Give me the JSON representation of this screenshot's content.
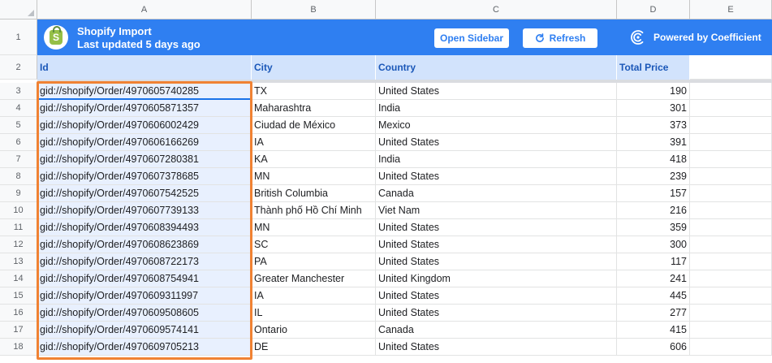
{
  "columns": [
    "A",
    "B",
    "C",
    "D",
    "E"
  ],
  "rows": [
    "1",
    "2",
    "3",
    "4",
    "5",
    "6",
    "7",
    "8",
    "9",
    "10",
    "11",
    "12",
    "13",
    "14",
    "15",
    "16",
    "17",
    "18"
  ],
  "banner": {
    "title": "Shopify Import",
    "subtitle": "Last updated 5 days ago",
    "open_sidebar_label": "Open Sidebar",
    "refresh_label": "Refresh",
    "powered_label": "Powered by Coefficient",
    "bg_color": "#2f7ff1"
  },
  "headers": [
    "Id",
    "City",
    "Country",
    "Total Price"
  ],
  "table": [
    {
      "id": "gid://shopify/Order/4970605740285",
      "city": "TX",
      "country": "United States",
      "price": "190"
    },
    {
      "id": "gid://shopify/Order/4970605871357",
      "city": "Maharashtra",
      "country": "India",
      "price": "301"
    },
    {
      "id": "gid://shopify/Order/4970606002429",
      "city": "Ciudad de México",
      "country": "Mexico",
      "price": "373"
    },
    {
      "id": "gid://shopify/Order/4970606166269",
      "city": "IA",
      "country": "United States",
      "price": "391"
    },
    {
      "id": "gid://shopify/Order/4970607280381",
      "city": "KA",
      "country": "India",
      "price": "418"
    },
    {
      "id": "gid://shopify/Order/4970607378685",
      "city": "MN",
      "country": "United States",
      "price": "239"
    },
    {
      "id": "gid://shopify/Order/4970607542525",
      "city": "British Columbia",
      "country": "Canada",
      "price": "157"
    },
    {
      "id": "gid://shopify/Order/4970607739133",
      "city": "Thành phố Hồ Chí Minh",
      "country": "Viet Nam",
      "price": "216"
    },
    {
      "id": "gid://shopify/Order/4970608394493",
      "city": "MN",
      "country": "United States",
      "price": "359"
    },
    {
      "id": "gid://shopify/Order/4970608623869",
      "city": "SC",
      "country": "United States",
      "price": "300"
    },
    {
      "id": "gid://shopify/Order/4970608722173",
      "city": "PA",
      "country": "United States",
      "price": "117"
    },
    {
      "id": "gid://shopify/Order/4970608754941",
      "city": "Greater Manchester",
      "country": "United Kingdom",
      "price": "241"
    },
    {
      "id": "gid://shopify/Order/4970609311997",
      "city": "IA",
      "country": "United States",
      "price": "445"
    },
    {
      "id": "gid://shopify/Order/4970609508605",
      "city": "IL",
      "country": "United States",
      "price": "277"
    },
    {
      "id": "gid://shopify/Order/4970609574141",
      "city": "Ontario",
      "country": "Canada",
      "price": "415"
    },
    {
      "id": "gid://shopify/Order/4970609705213",
      "city": "DE",
      "country": "United States",
      "price": "606"
    }
  ],
  "colors": {
    "selection_outline": "#f08233",
    "header_fill": "#d2e3fc",
    "header_text": "#1a57b8",
    "selected_fill": "#e8f0fe"
  }
}
